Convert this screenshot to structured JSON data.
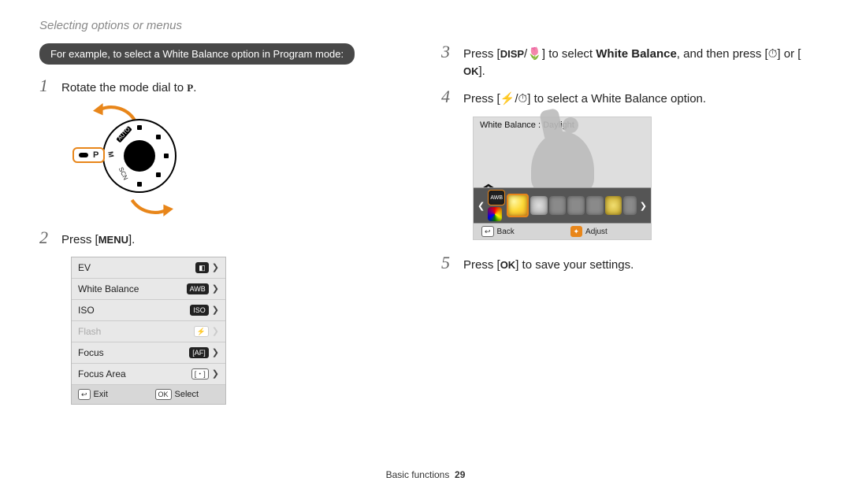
{
  "header": "Selecting options or menus",
  "pill": "For example, to select a White Balance option in Program mode:",
  "P_glyph": "P",
  "MENU_key": "MENU",
  "OK_key": "OK",
  "DISP_key": "DISP",
  "macro_icon": "🌷",
  "flash_icon": "⚡",
  "timer_icon": "⏱",
  "steps": {
    "s1a": "Rotate the mode dial to ",
    "s1b": ".",
    "s2a": "Press [",
    "s2b": "].",
    "s3a": "Press [",
    "s3b": "/",
    "s3c": "] to select ",
    "s3bold": "White Balance",
    "s3d": ", and then press [",
    "s3e": "] or [",
    "s3f": "].",
    "s4a": "Press [",
    "s4b": "/",
    "s4c": "] to select a White Balance option.",
    "s5a": "Press [",
    "s5b": "] to save your settings."
  },
  "menu": {
    "items": [
      "EV",
      "White Balance",
      "ISO",
      "Flash",
      "Focus",
      "Focus Area"
    ],
    "flash_index": 3,
    "icon_desc": [
      "exposure-bar",
      "AWB",
      "ISO",
      "flash",
      "AF-focus",
      "target"
    ],
    "footer_left_glyph": "↩",
    "footer_left": "Exit",
    "footer_right_glyph": "OK",
    "footer_right": "Select",
    "chevron": "❯"
  },
  "wb_panel": {
    "title": "White Balance : Daylight",
    "none_glyph": "AWB",
    "left_caret": "❮",
    "right_caret": "❯",
    "up_caret": "❯",
    "back_glyph": "↩",
    "back": "Back",
    "adjust_glyph": "✦",
    "adjust": "Adjust"
  },
  "footer": {
    "label": "Basic functions",
    "page": "29"
  }
}
